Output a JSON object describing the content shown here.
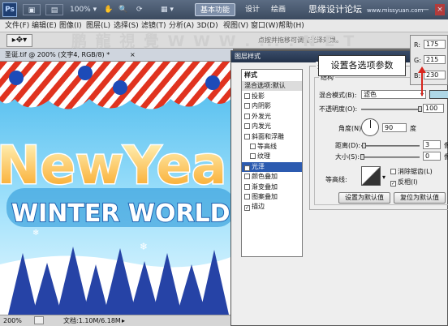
{
  "app": {
    "logo": "Ps",
    "workspace_button": "基本功能",
    "workspace_tabs": [
      "设计",
      "绘画"
    ],
    "watermark_right": "思缘设计论坛",
    "watermark_url": "www.missyuan.com",
    "minimize": "—",
    "close": "×"
  },
  "menu": [
    "文件(F)",
    "编辑(E)",
    "图像(I)",
    "图层(L)",
    "选择(S)",
    "滤镜(T)",
    "分析(A)",
    "3D(D)",
    "视图(V)",
    "窗口(W)",
    "帮助(H)"
  ],
  "options_bar": {
    "hint": "点按并拖移可调整光泽效果。",
    "watermark": "鹏 龍 視 覺 W W W . ... . N E T"
  },
  "document": {
    "tab_title": "圣诞.tif @ 200% (文字4, RGB/8) *",
    "tab_close": "×",
    "art_line1": "NewYea",
    "art_line2": "WINTER WORLD"
  },
  "status": {
    "zoom": "200%",
    "doc_info": "文档:1.10M/6.18M"
  },
  "dialog": {
    "title": "图层样式",
    "styles_header": "样式",
    "blend_default": "混合选项:默认",
    "effects": [
      {
        "label": "投影",
        "checked": false,
        "indent": false
      },
      {
        "label": "内阴影",
        "checked": false,
        "indent": false
      },
      {
        "label": "外发光",
        "checked": false,
        "indent": false
      },
      {
        "label": "内发光",
        "checked": false,
        "indent": false
      },
      {
        "label": "斜面和浮雕",
        "checked": false,
        "indent": false
      },
      {
        "label": "等高线",
        "checked": false,
        "indent": true
      },
      {
        "label": "纹理",
        "checked": false,
        "indent": true
      },
      {
        "label": "光泽",
        "checked": true,
        "indent": false,
        "selected": true
      },
      {
        "label": "颜色叠加",
        "checked": false,
        "indent": false
      },
      {
        "label": "渐变叠加",
        "checked": false,
        "indent": false
      },
      {
        "label": "图案叠加",
        "checked": false,
        "indent": false
      },
      {
        "label": "描边",
        "checked": true,
        "indent": false
      }
    ],
    "group_partial": "光",
    "structure_label": "结构",
    "blend_mode_label": "混合模式(B):",
    "blend_mode_value": "滤色",
    "opacity_label": "不透明度(O):",
    "opacity_value": "100",
    "angle_label": "角度(N):",
    "angle_value": "90",
    "angle_unit": "度",
    "distance_label": "距离(D):",
    "distance_value": "3",
    "size_label": "大小(S):",
    "size_value": "0",
    "contour_label": "等高线:",
    "antialias_label": "消除锯齿(L)",
    "antialias_checked": false,
    "invert_label": "反相(I)",
    "invert_checked": true,
    "default_button": "设置为默认值",
    "reset_button": "复位为默认值",
    "unit_cut": "像"
  },
  "color_readout": {
    "r_label": "R:",
    "r": "175",
    "g_label": "G:",
    "g": "215",
    "b_label": "B:",
    "b": "230",
    "swatch": "#afd7e6"
  },
  "callout": {
    "text": "设置各选项参数"
  },
  "colors": {
    "accent_red": "#d8261e",
    "sky": "#8ed5f5"
  }
}
